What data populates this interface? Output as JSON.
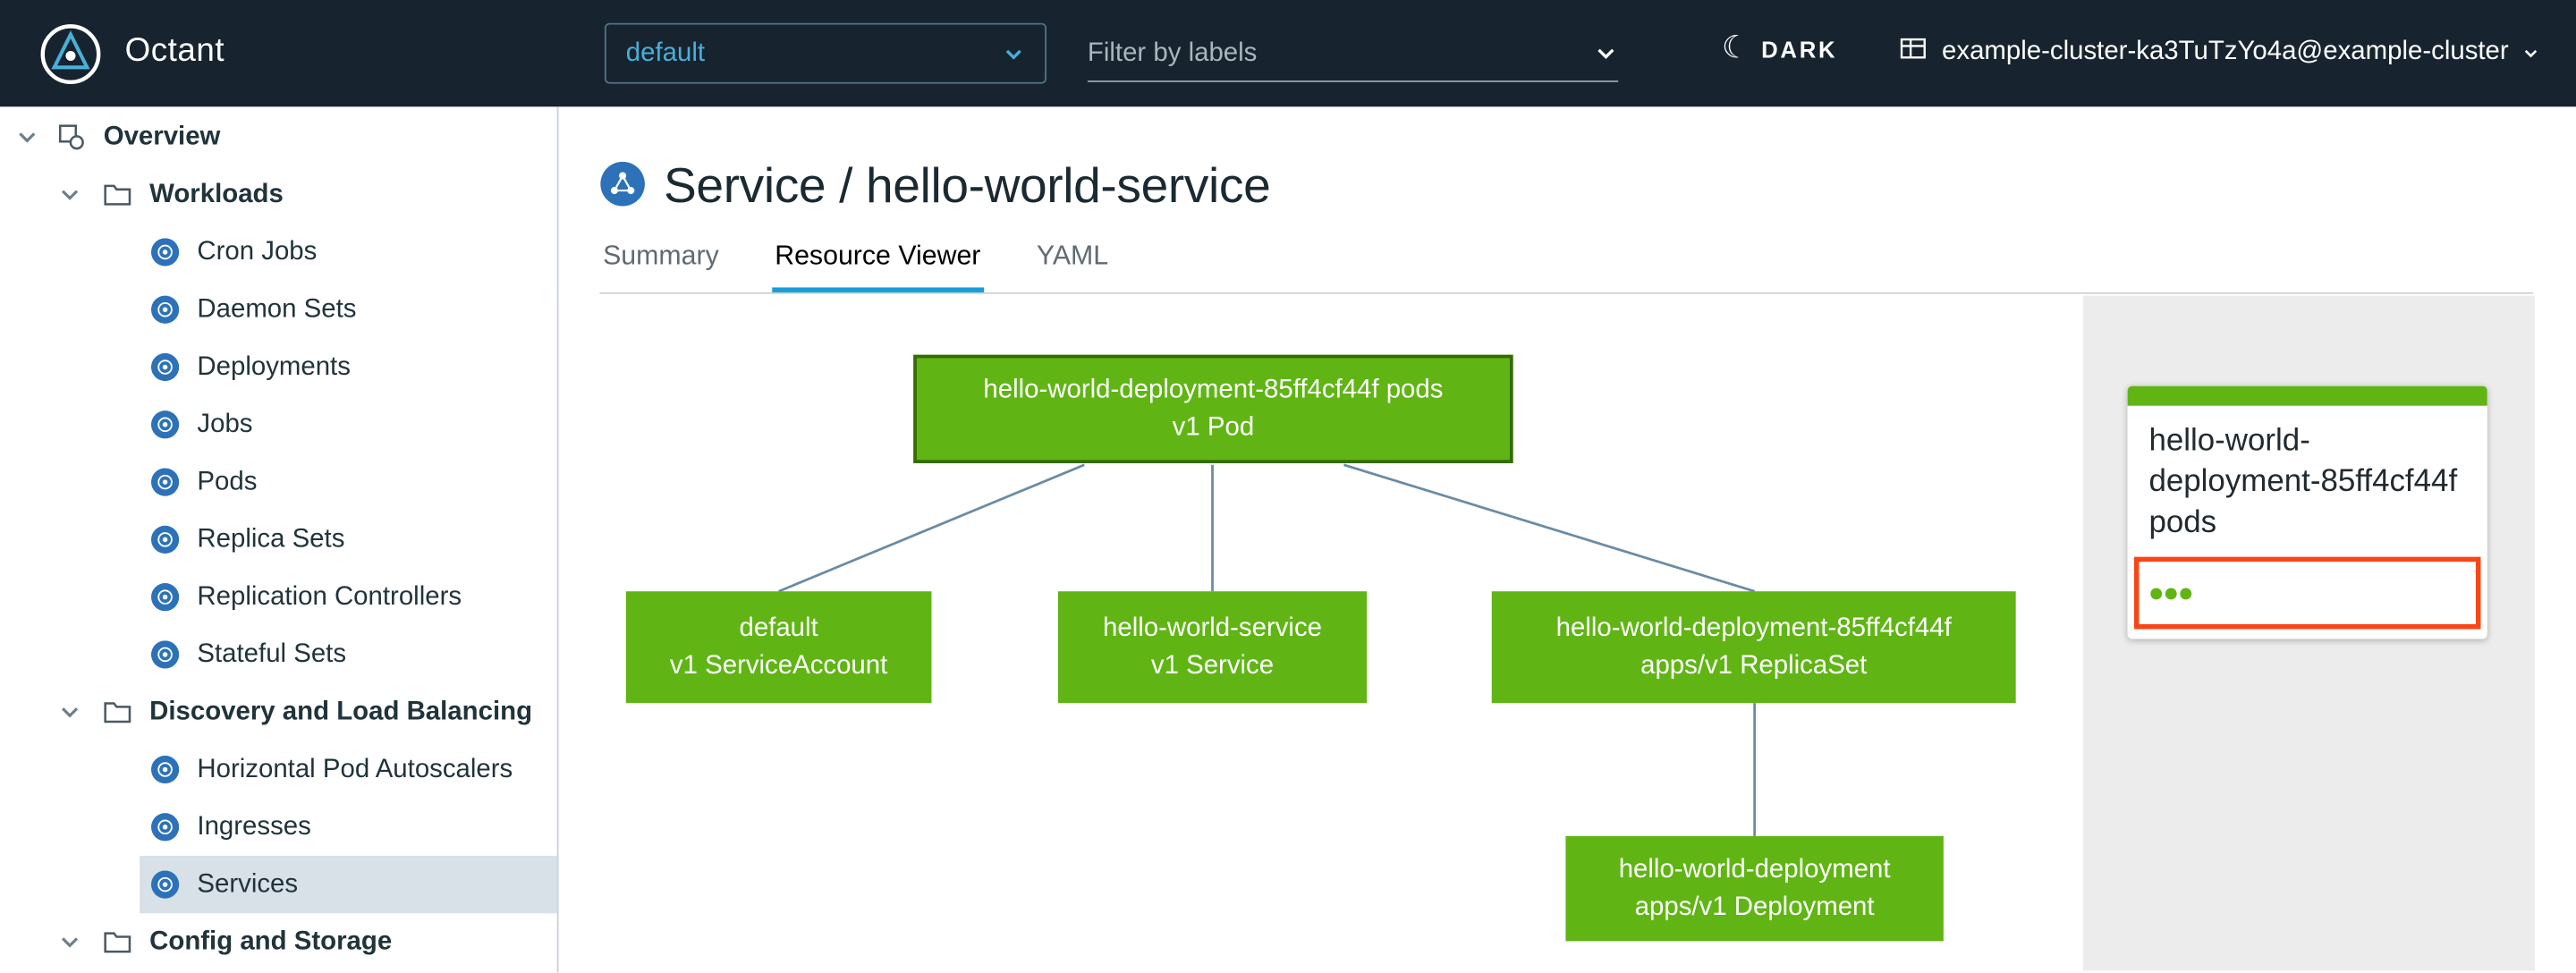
{
  "header": {
    "app_name": "Octant",
    "namespace_dropdown": {
      "value": "default"
    },
    "filter_input": {
      "placeholder": "Filter by labels"
    },
    "theme_toggle_label": "DARK",
    "cluster_menu_label": "example-cluster-ka3TuTzYo4a@example-cluster"
  },
  "sidebar": {
    "items": [
      {
        "label": "Overview",
        "level": 0,
        "type": "section"
      },
      {
        "label": "Workloads",
        "level": 1,
        "type": "group"
      },
      {
        "label": "Cron Jobs",
        "level": 2,
        "type": "resource"
      },
      {
        "label": "Daemon Sets",
        "level": 2,
        "type": "resource"
      },
      {
        "label": "Deployments",
        "level": 2,
        "type": "resource"
      },
      {
        "label": "Jobs",
        "level": 2,
        "type": "resource"
      },
      {
        "label": "Pods",
        "level": 2,
        "type": "resource"
      },
      {
        "label": "Replica Sets",
        "level": 2,
        "type": "resource"
      },
      {
        "label": "Replication Controllers",
        "level": 2,
        "type": "resource"
      },
      {
        "label": "Stateful Sets",
        "level": 2,
        "type": "resource"
      },
      {
        "label": "Discovery and Load Balancing",
        "level": 1,
        "type": "group"
      },
      {
        "label": "Horizontal Pod Autoscalers",
        "level": 2,
        "type": "resource"
      },
      {
        "label": "Ingresses",
        "level": 2,
        "type": "resource"
      },
      {
        "label": "Services",
        "level": 2,
        "type": "resource",
        "selected": true
      },
      {
        "label": "Config and Storage",
        "level": 1,
        "type": "group"
      }
    ]
  },
  "main": {
    "page_title": "Service / hello-world-service",
    "tabs": [
      {
        "label": "Summary",
        "active": false
      },
      {
        "label": "Resource Viewer",
        "active": true
      },
      {
        "label": "YAML",
        "active": false
      }
    ]
  },
  "graph": {
    "nodes": [
      {
        "id": "pods",
        "line1": "hello-world-deployment-85ff4cf44f pods",
        "line2": "v1 Pod",
        "selected": true
      },
      {
        "id": "serviceaccount",
        "line1": "default",
        "line2": "v1 ServiceAccount",
        "selected": false
      },
      {
        "id": "service",
        "line1": "hello-world-service",
        "line2": "v1 Service",
        "selected": false
      },
      {
        "id": "replicaset",
        "line1": "hello-world-deployment-85ff4cf44f",
        "line2": "apps/v1 ReplicaSet",
        "selected": false
      },
      {
        "id": "deployment",
        "line1": "hello-world-deployment",
        "line2": "apps/v1 Deployment",
        "selected": false
      }
    ],
    "edges": [
      [
        "pods",
        "serviceaccount"
      ],
      [
        "pods",
        "service"
      ],
      [
        "pods",
        "replicaset"
      ],
      [
        "replicaset",
        "deployment"
      ]
    ]
  },
  "detail_panel": {
    "card_title": "hello-world-deployment-85ff4cf44f pods",
    "status_dots": 3
  },
  "colors": {
    "header_bg": "#17242f",
    "accent_blue": "#49afd9",
    "node_green": "#60b515",
    "selection_red": "#fa4616",
    "tab_active_underline": "#189dd9"
  }
}
